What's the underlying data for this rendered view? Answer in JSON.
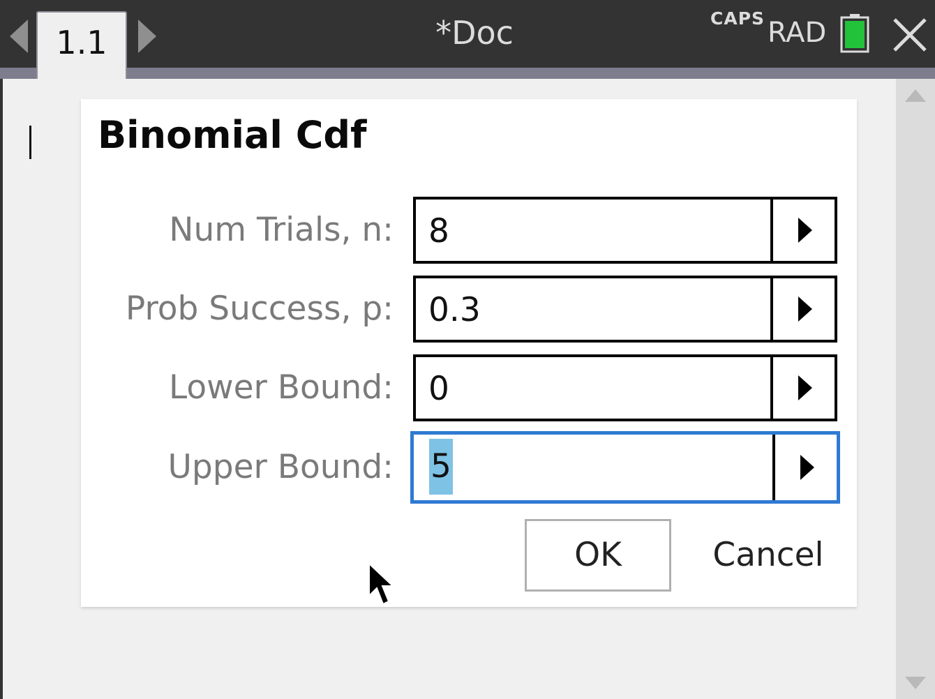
{
  "topbar": {
    "tab_label": "1.1",
    "doc_title": "*Doc",
    "caps_indicator": "CAPS",
    "angle_mode": "RAD",
    "colors": {
      "bar": "#333333",
      "battery_fill": "#22c33a"
    }
  },
  "dialog": {
    "title": "Binomial Cdf",
    "fields": [
      {
        "label": "Num Trials, n:",
        "value": "8"
      },
      {
        "label": "Prob Success, p:",
        "value": "0.3"
      },
      {
        "label": "Lower Bound:",
        "value": "0"
      },
      {
        "label": "Upper Bound:",
        "value": "5"
      }
    ],
    "active_field_index": 3,
    "ok_label": "OK",
    "cancel_label": "Cancel",
    "colors": {
      "focus": "#2f7ad2",
      "selection": "#7ec2e6"
    }
  }
}
